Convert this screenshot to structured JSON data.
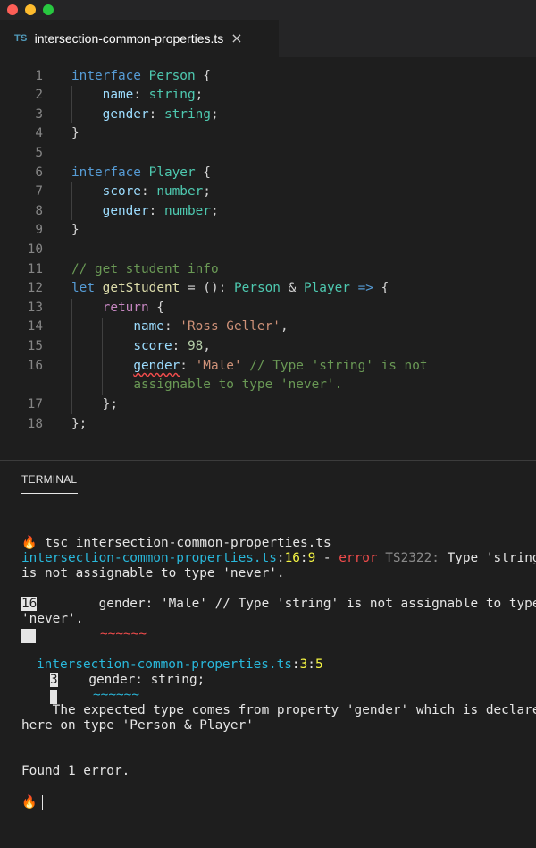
{
  "window": {
    "controls": [
      "close",
      "minimize",
      "maximize"
    ]
  },
  "tab": {
    "icon_label": "TS",
    "title": "intersection-common-properties.ts",
    "close_glyph": "×"
  },
  "editor": {
    "line_numbers": [
      "1",
      "2",
      "3",
      "4",
      "5",
      "6",
      "7",
      "8",
      "9",
      "10",
      "11",
      "12",
      "13",
      "14",
      "15",
      "16",
      "",
      "17",
      "18"
    ],
    "lines": [
      {
        "kw": "interface",
        "name": "Person",
        "open": " {"
      },
      {
        "prop": "name",
        "colon": ": ",
        "type": "string",
        "end": ";"
      },
      {
        "prop": "gender",
        "colon": ": ",
        "type": "string",
        "end": ";"
      },
      {
        "close": "}"
      },
      {},
      {
        "kw": "interface",
        "name": "Player",
        "open": " {"
      },
      {
        "prop": "score",
        "colon": ": ",
        "type": "number",
        "end": ";"
      },
      {
        "prop": "gender",
        "colon": ": ",
        "type": "number",
        "end": ";"
      },
      {
        "close": "}"
      },
      {},
      {
        "comment": "// get student info"
      },
      {
        "kw": "let",
        "fn": "getStudent",
        "eq": " = (): ",
        "t1": "Person",
        "amp": " & ",
        "t2": "Player",
        "arrow": " =>",
        "open": " {"
      },
      {
        "kw": "return",
        "open": " {"
      },
      {
        "prop": "name",
        "colon": ": ",
        "str": "'Ross Geller'",
        "end": ","
      },
      {
        "prop": "score",
        "colon": ": ",
        "num": "98",
        "end": ","
      },
      {
        "prop": "gender",
        "colon": ": ",
        "str": "'Male'",
        "comment": " // Type 'string' is not"
      },
      {
        "comment": "assignable to type 'never'."
      },
      {
        "close": "};",
        "text": "};"
      },
      {
        "close": "};"
      }
    ]
  },
  "panel": {
    "tab_label": "TERMINAL"
  },
  "terminal": {
    "prompt_icon": "🔥",
    "command": " tsc intersection-common-properties.ts",
    "error_file": "intersection-common-properties.ts",
    "error_pos_sep1": ":",
    "error_line": "16",
    "error_pos_sep2": ":",
    "error_col": "9",
    "error_dash": " - ",
    "error_word": "error",
    "error_code": " TS2322:",
    "error_msg_1": " Type 'string'",
    "error_msg_2": "is not assignable to type 'never'.",
    "snippet_line_no": "16",
    "snippet_text_1": "        gender: 'Male' // Type 'string' is not assignable to type",
    "snippet_text_2": "'never'.",
    "snippet_wave": "~~~~~~",
    "related_file": "intersection-common-properties.ts",
    "related_sep1": ":",
    "related_line": "3",
    "related_sep2": ":",
    "related_col": "5",
    "related_line_no": "3",
    "related_text": "    gender: string;",
    "related_wave": "~~~~~~",
    "related_msg_1": "    The expected type comes from property 'gender' which is declared",
    "related_msg_2": "here on type 'Person & Player'",
    "found": "Found 1 error."
  },
  "colors": {
    "background": "#1e1e1e",
    "keyword": "#569cd6",
    "type": "#4ec9b0",
    "property": "#9cdcfe",
    "string": "#ce9178",
    "number": "#b5cea8",
    "comment": "#6a9955",
    "terminal_cyan": "#29b8db",
    "terminal_yellow": "#f5f543",
    "terminal_red": "#f14c4c"
  }
}
